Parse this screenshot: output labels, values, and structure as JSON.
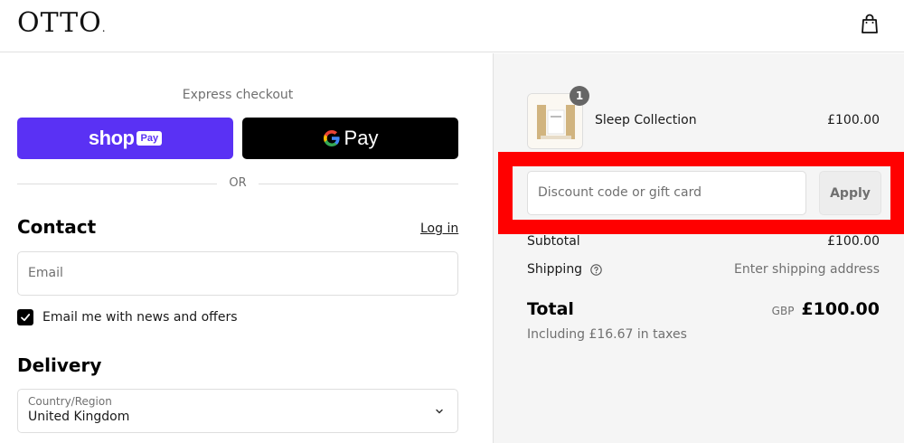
{
  "header": {
    "logo": "OTTO",
    "logo_dot": ".",
    "cart_icon": "shopping-bag-icon"
  },
  "express": {
    "title": "Express checkout",
    "shop_pay_word": "shop",
    "shop_pay_badge": "Pay",
    "gpay_word": "Pay",
    "or_text": "OR"
  },
  "contact": {
    "heading": "Contact",
    "login_label": "Log in",
    "email_placeholder": "Email",
    "newsletter_label": "Email me with news and offers",
    "newsletter_checked": true
  },
  "delivery": {
    "heading": "Delivery",
    "country_label": "Country/Region",
    "country_value": "United Kingdom"
  },
  "summary": {
    "product_name": "Sleep Collection",
    "product_price": "£100.00",
    "quantity": "1",
    "discount_placeholder": "Discount code or gift card",
    "apply_label": "Apply",
    "subtotal_label": "Subtotal",
    "subtotal_value": "£100.00",
    "shipping_label": "Shipping",
    "shipping_value": "Enter shipping address",
    "total_label": "Total",
    "currency": "GBP",
    "total_value": "£100.00",
    "taxes_note": "Including £16.67 in taxes"
  },
  "colors": {
    "shop_pay": "#5a31f4",
    "gpay": "#000000",
    "highlight": "#ff0000"
  }
}
